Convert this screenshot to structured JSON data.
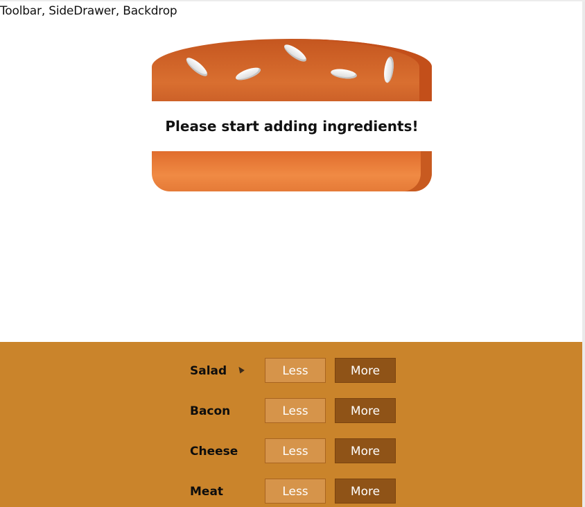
{
  "header": {
    "text": "Toolbar, SideDrawer, Backdrop"
  },
  "burger": {
    "prompt": "Please start adding ingredients!"
  },
  "controls": [
    {
      "label": "Salad",
      "less": "Less",
      "more": "More"
    },
    {
      "label": "Bacon",
      "less": "Less",
      "more": "More"
    },
    {
      "label": "Cheese",
      "less": "Less",
      "more": "More"
    },
    {
      "label": "Meat",
      "less": "Less",
      "more": "More"
    }
  ],
  "colors": {
    "controls_bg": "#ca842b",
    "less_button": "#d6944a",
    "more_button": "#8f5317",
    "bread_top": "#d96f30",
    "bread_bottom": "#f08a44"
  },
  "icons": {
    "cursor": "mouse-pointer-icon"
  }
}
